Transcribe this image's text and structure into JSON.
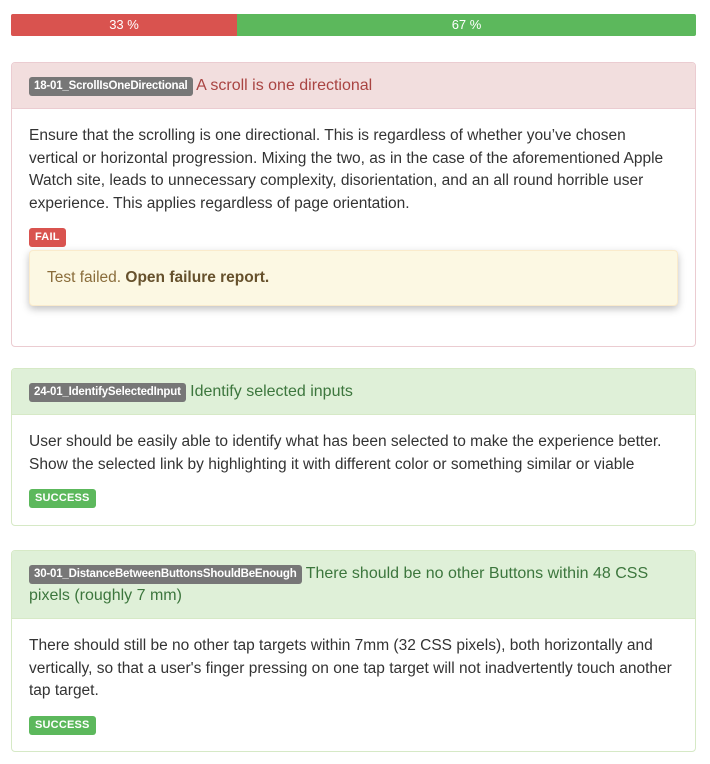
{
  "progress": {
    "fail_label": "33 %",
    "fail_fraction": 0.33,
    "success_label": "67 %",
    "success_fraction": 0.67,
    "colors": {
      "fail": "#d9534f",
      "success": "#5cb85c"
    }
  },
  "tests": [
    {
      "id": "18-01_ScrollIsOneDirectional",
      "title": "A scroll is one directional",
      "description": "Ensure that the scrolling is one directional. This is regardless of whether you’ve chosen vertical or horizontal progression. Mixing the two, as in the case of the aforementioned Apple Watch site, leads to unnecessary complexity, disorientation, and an all round horrible user experience. This applies regardless of page orientation.",
      "status": "FAIL",
      "alert_text": "Test failed. ",
      "alert_link": "Open failure report."
    },
    {
      "id": "24-01_IdentifySelectedInput",
      "title": "Identify selected inputs",
      "description": "User should be easily able to identify what has been selected to make the experience better. Show the selected link by highlighting it with different color or something similar or viable",
      "status": "SUCCESS"
    },
    {
      "id": "30-01_DistanceBetweenButtonsShouldBeEnough",
      "title": "There should be no other Buttons within 48 CSS pixels (roughly 7 mm)",
      "description": "There should still be no other tap targets within 7mm (32 CSS pixels), both horizontally and vertically, so that a user's finger pressing on one tap target will not inadvertently touch another tap target.",
      "status": "SUCCESS"
    }
  ]
}
